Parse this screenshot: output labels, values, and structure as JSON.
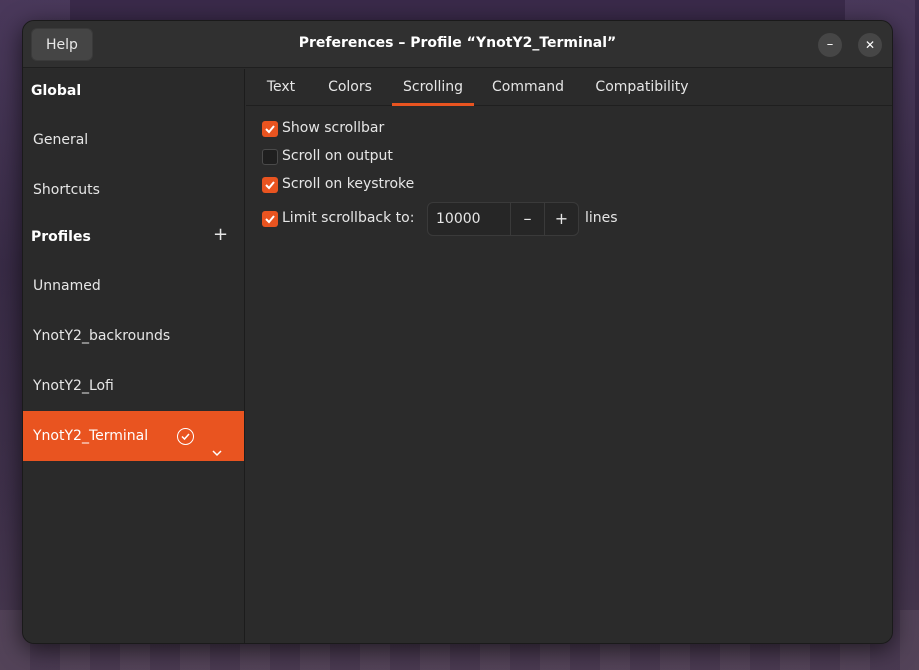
{
  "window": {
    "title": "Preferences – Profile “YnotY2_Terminal”"
  },
  "header": {
    "help_label": "Help",
    "minimize_glyph": "–",
    "close_glyph": "✕"
  },
  "sidebar": {
    "global_header": "Global",
    "general": "General",
    "shortcuts": "Shortcuts",
    "profiles_header": "Profiles",
    "add_glyph": "+",
    "profiles": [
      "Unnamed",
      "YnotY2_backrounds",
      "YnotY2_Lofi",
      "YnotY2_Terminal"
    ],
    "active_profile": "YnotY2_Terminal"
  },
  "tabs": [
    {
      "label": "Text"
    },
    {
      "label": "Colors"
    },
    {
      "label": "Scrolling",
      "active": true
    },
    {
      "label": "Command"
    },
    {
      "label": "Compatibility"
    }
  ],
  "scrolling": {
    "show_scrollbar": {
      "label": "Show scrollbar",
      "checked": true
    },
    "scroll_on_output": {
      "label": "Scroll on output",
      "checked": false
    },
    "scroll_on_keystroke": {
      "label": "Scroll on keystroke",
      "checked": true
    },
    "limit_scrollback": {
      "label": "Limit scrollback to:",
      "checked": true
    },
    "scrollback_value": "10000",
    "minus_glyph": "–",
    "plus_glyph": "+",
    "lines_label": "lines"
  },
  "colors": {
    "accent": "#e95420",
    "bg": "#2b2b2b",
    "text": "#e6e6e6"
  },
  "icons": [
    "minimize-icon",
    "close-icon",
    "add-icon",
    "check-circle-icon",
    "chevron-down-icon",
    "checkmark-icon"
  ]
}
